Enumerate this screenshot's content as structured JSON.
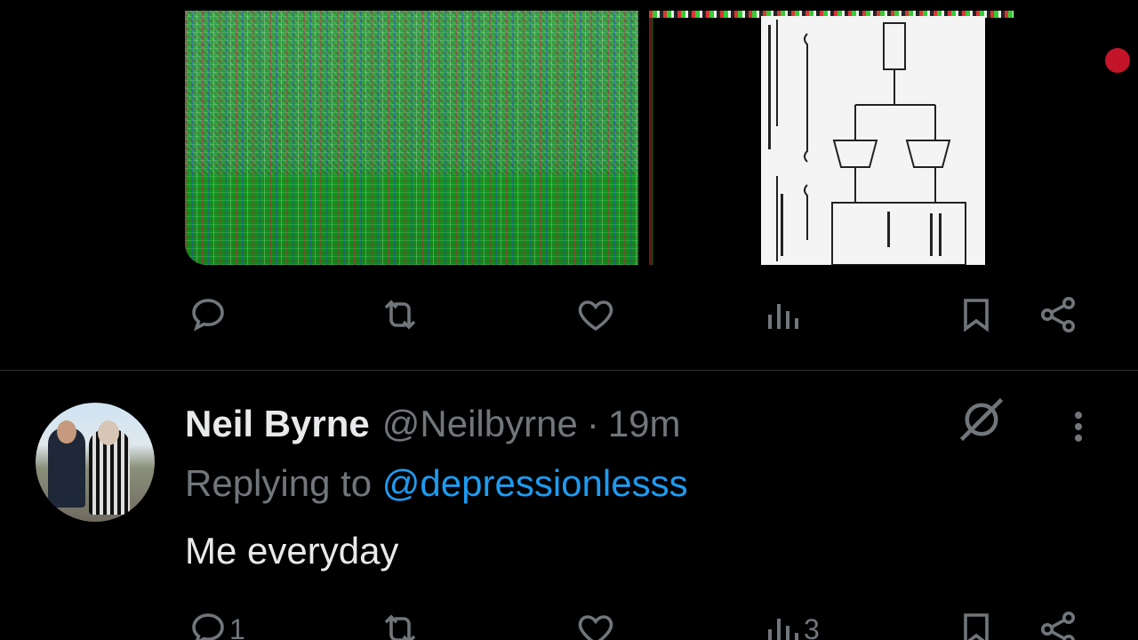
{
  "app": "X",
  "top_tweet": {
    "media": [
      {
        "type": "image",
        "description_icon": "glitched-image"
      },
      {
        "type": "image",
        "description_icon": "document-image"
      }
    ],
    "actions": {
      "reply_count": "",
      "retweet_count": "",
      "like_count": "",
      "views_count": ""
    }
  },
  "reply": {
    "display_name": "Neil Byrne",
    "handle": "@Neilbyrne",
    "separator": "·",
    "time": "19m",
    "replying_prefix": "Replying to",
    "replying_to": "@depressionlesss",
    "text": "Me everyday",
    "actions": {
      "reply_count": "1",
      "retweet_count": "",
      "like_count": "",
      "views_count": "3"
    }
  },
  "colors": {
    "background": "#000000",
    "text_primary": "#e7e9ea",
    "text_secondary": "#71767b",
    "link": "#1d9bf0",
    "divider": "#2f3336",
    "recording_dot": "#c4142a"
  },
  "icons": [
    "reply-icon",
    "retweet-icon",
    "like-icon",
    "views-icon",
    "bookmark-icon",
    "share-icon",
    "grok-icon",
    "more-icon"
  ]
}
